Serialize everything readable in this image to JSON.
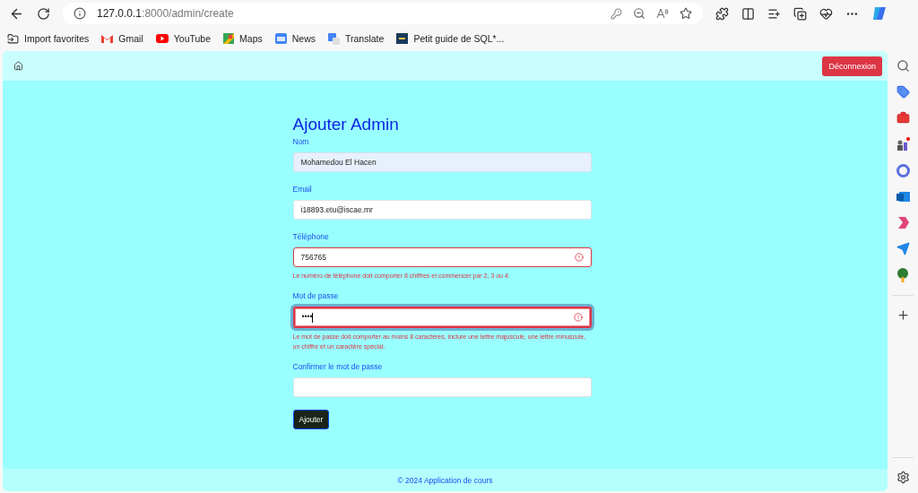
{
  "browser": {
    "url_host": "127.0.0.1",
    "url_rest": ":8000/admin/create",
    "bookmarks": [
      {
        "label": "Import favorites",
        "kind": "import"
      },
      {
        "label": "Gmail",
        "kind": "mail"
      },
      {
        "label": "YouTube",
        "kind": "video"
      },
      {
        "label": "Maps",
        "kind": "map"
      },
      {
        "label": "News",
        "kind": "news"
      },
      {
        "label": "Translate",
        "kind": "translate"
      },
      {
        "label": "Petit guide de SQL*...",
        "kind": "doc"
      }
    ]
  },
  "navbar": {
    "logout": "Déconnexion"
  },
  "form": {
    "title": "Ajouter Admin",
    "fields": [
      {
        "label": "Nom",
        "value": "Mohamedou El Hacen",
        "autofilled": true,
        "invalid": false,
        "focused": false
      },
      {
        "label": "Email",
        "value": "i18893.etu@iscae.mr",
        "autofilled": false,
        "invalid": false,
        "focused": false
      },
      {
        "label": "Téléphone",
        "value": "756765",
        "autofilled": false,
        "invalid": true,
        "focused": false,
        "error": "Le numéro de téléphone doit comporter 8 chiffres et commencer par 2, 3 ou 4."
      },
      {
        "label": "Mot de passe",
        "value": "••••",
        "autofilled": false,
        "invalid": true,
        "focused": true,
        "error": "Le mot de passe doit comporter au moins 8 caractères, inclure une lettre majuscule, une lettre minuscule, un chiffre et un caractère spécial."
      },
      {
        "label": "Confirmer le mot de passe",
        "autofilled": false,
        "invalid": false,
        "focused": false
      }
    ],
    "submit": "Ajouter"
  },
  "footer": "© 2024 Application de cours"
}
